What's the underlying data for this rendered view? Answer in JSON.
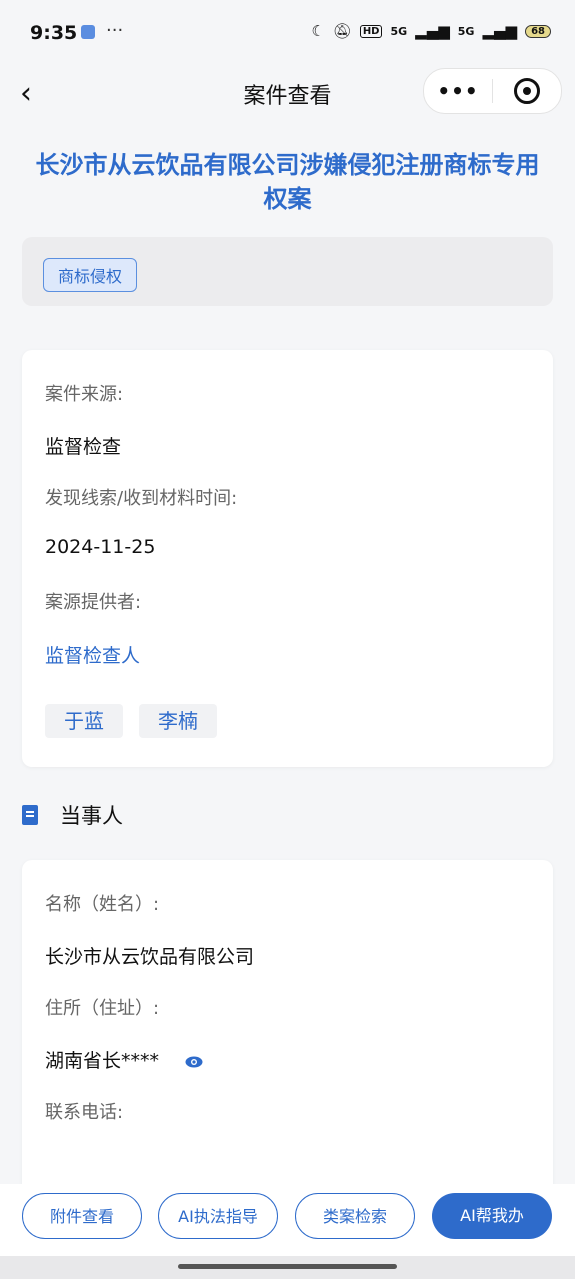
{
  "status_bar": {
    "time": "9:35",
    "more": "···",
    "hd": "HD",
    "signal1": "5G",
    "signal2": "5G",
    "battery": "68"
  },
  "nav": {
    "back": "‹",
    "title": "案件查看",
    "more": "•••"
  },
  "case": {
    "title": "长沙市从云饮品有限公司涉嫌侵犯注册商标专用权案",
    "tag": "商标侵权"
  },
  "info_card": {
    "source_label": "案件来源:",
    "source_value": "监督检查",
    "time_label": "发现线索/收到材料时间:",
    "time_value": "2024-11-25",
    "provider_label": "案源提供者:",
    "provider_value": "监督检查人",
    "persons": [
      "于蓝",
      "李楠"
    ]
  },
  "party_section": {
    "title": "当事人",
    "name_label": "名称（姓名）:",
    "name_value": "长沙市从云饮品有限公司",
    "address_label": "住所（住址）:",
    "address_value": "湖南省长****",
    "phone_label": "联系电话:"
  },
  "bottom_buttons": {
    "attachments": "附件查看",
    "ai_guide": "AI执法指导",
    "similar_cases": "类案检索",
    "ai_help": "AI帮我办"
  },
  "colors": {
    "accent": "#2e6bcb",
    "background": "#f5f6f8"
  }
}
